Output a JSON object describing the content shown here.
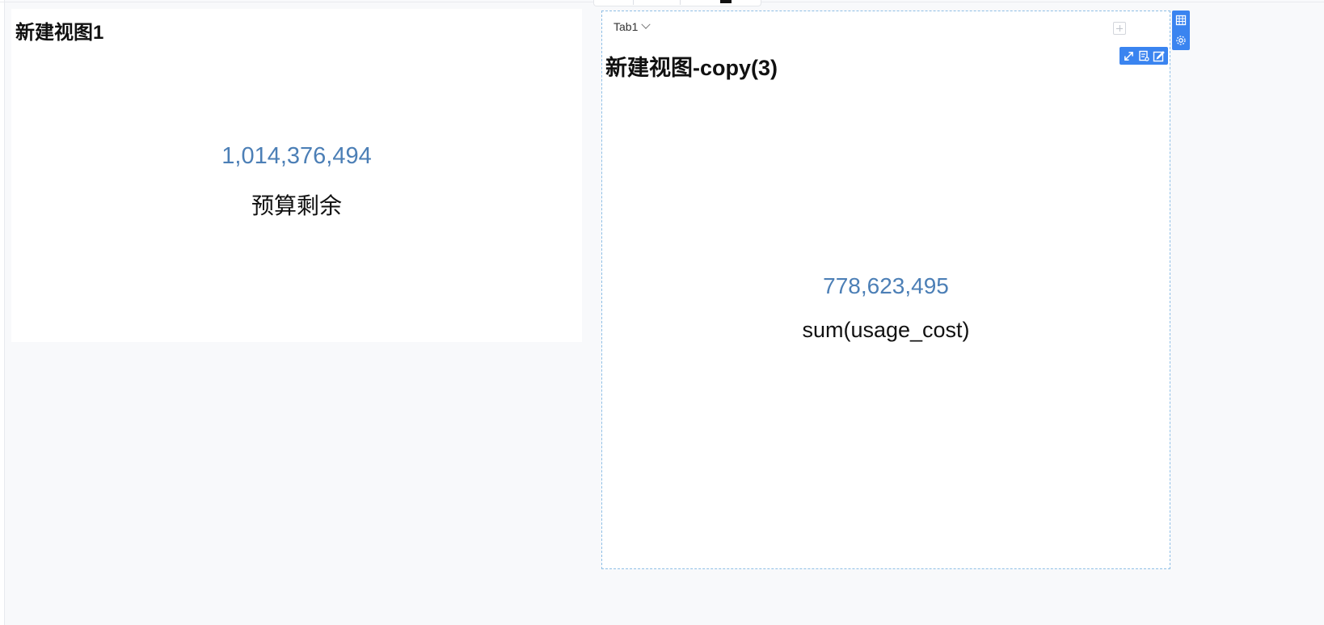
{
  "panel_left": {
    "title": "新建视图1",
    "kpi_value": "1,014,376,494",
    "kpi_label": "预算剩余"
  },
  "panel_right": {
    "tab": {
      "label": "Tab1"
    },
    "title": "新建视图-copy(3)",
    "kpi_value": "778,623,495",
    "kpi_label": "sum(usage_cost)"
  },
  "colors": {
    "kpi_value": "#4c7fb6",
    "accent": "#3a84f0",
    "selection_border": "#8fbfe6"
  },
  "icons": {
    "view_tools": [
      "expand-icon",
      "details-icon",
      "edit-icon"
    ],
    "side_tools": [
      "grid-icon",
      "settings-icon"
    ],
    "tab": [
      "chevron-down-icon",
      "add-tab-icon"
    ]
  }
}
